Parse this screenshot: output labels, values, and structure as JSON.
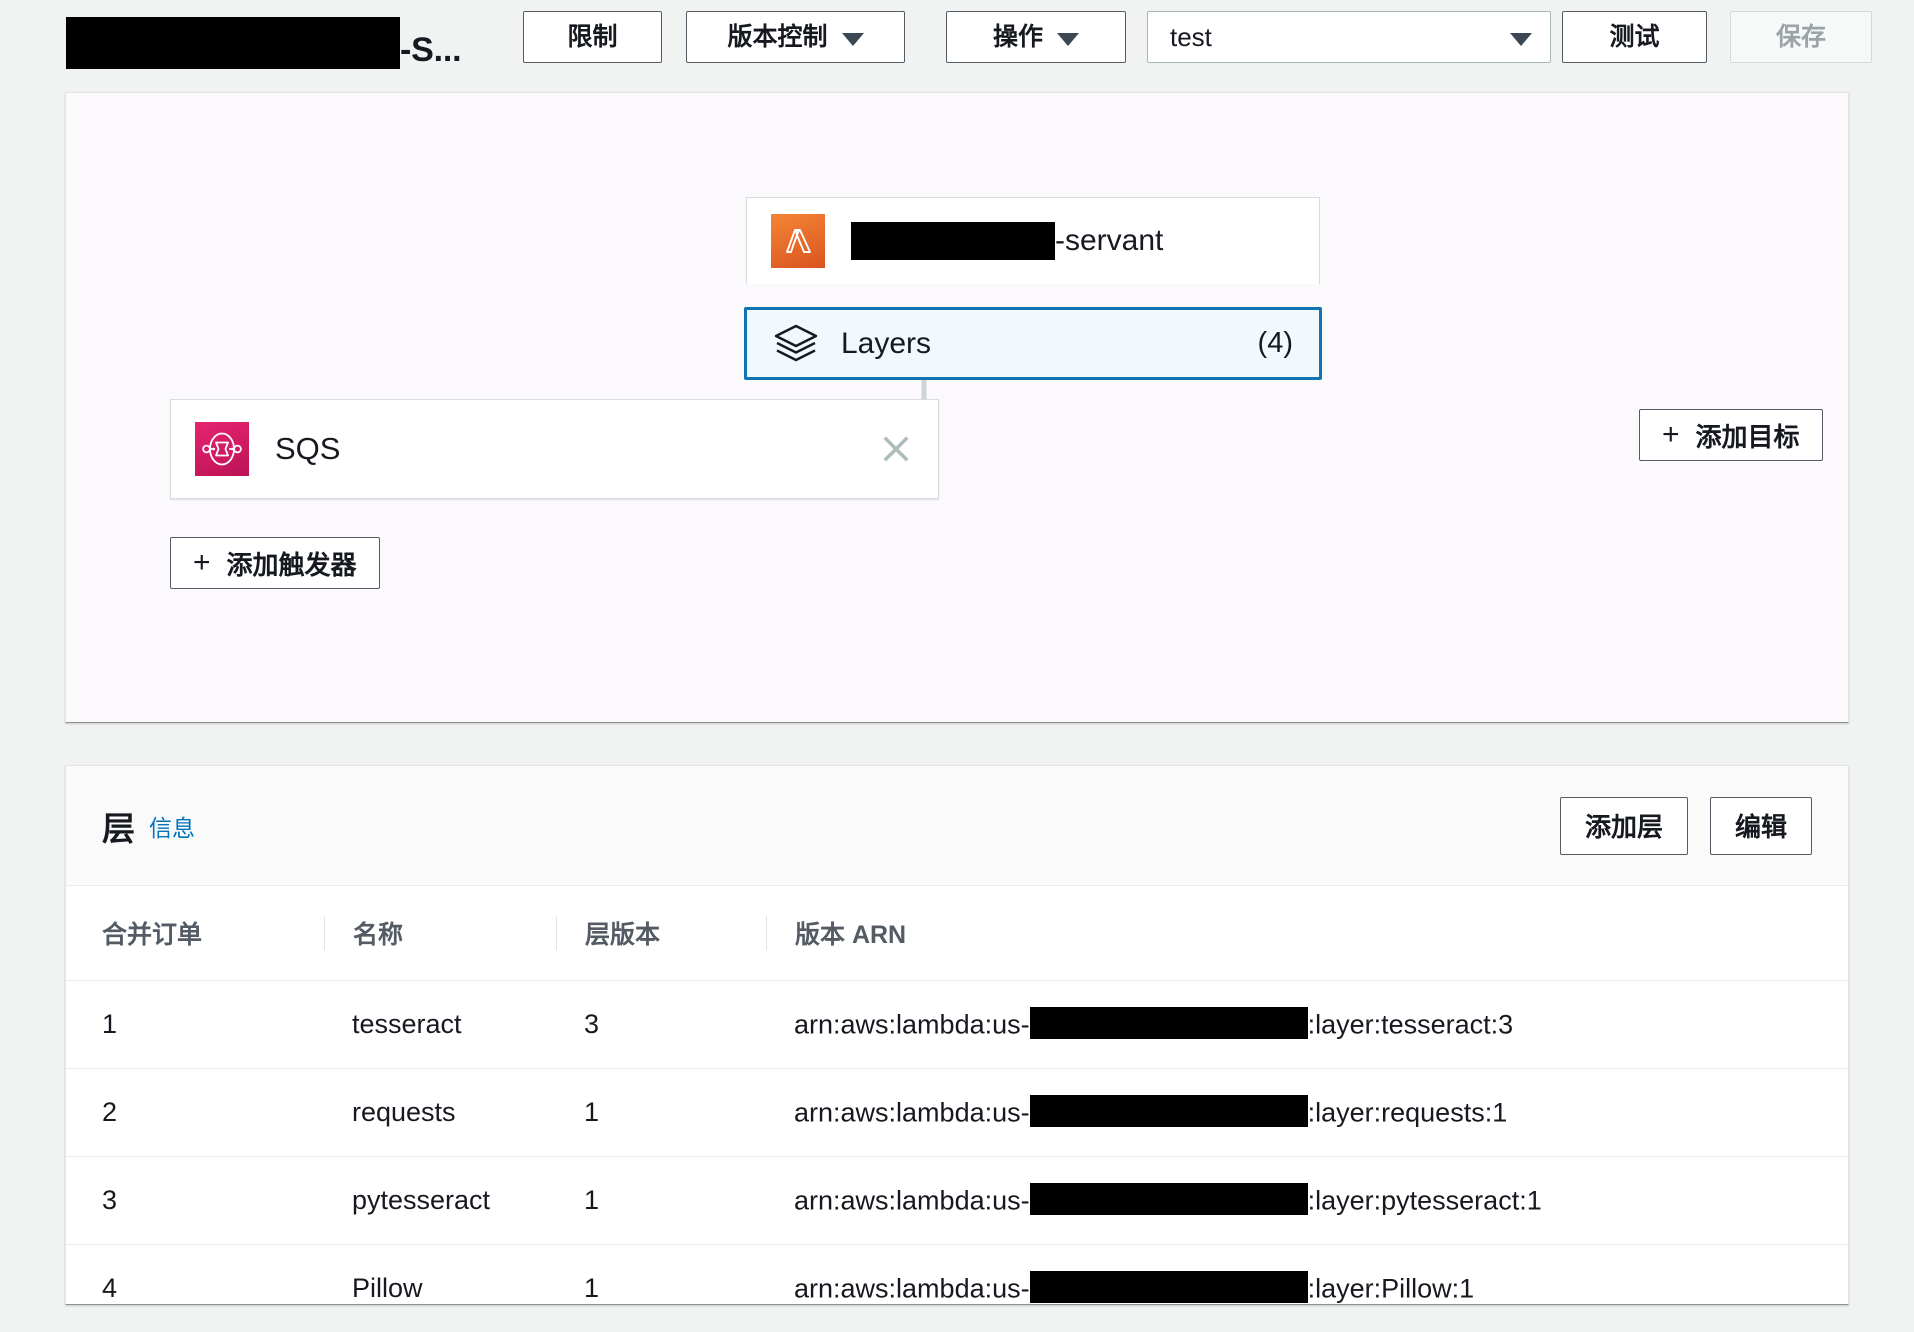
{
  "topbar": {
    "function_title_suffix": "-S...",
    "function_title_redacted": true,
    "buttons": {
      "throttle": "限制",
      "version_control": "版本控制",
      "actions": "操作",
      "test": "测试",
      "save": "保存"
    },
    "test_event_select": {
      "value": "test"
    }
  },
  "diagram": {
    "lambda_node": {
      "name_suffix": "-servant",
      "icon": "aws-lambda-icon"
    },
    "layers_node": {
      "label": "Layers",
      "count": "(4)",
      "icon": "layers-stack-icon",
      "selected": true
    },
    "trigger_card": {
      "label": "SQS",
      "icon": "aws-sqs-icon",
      "close_icon": "close-icon"
    },
    "add_trigger_button": "添加触发器",
    "add_target_button": "添加目标",
    "plus_glyph": "+"
  },
  "layers_panel": {
    "title": "层",
    "info_link": "信息",
    "add_layer_button": "添加层",
    "edit_button": "编辑",
    "columns": [
      "合并订单",
      "名称",
      "层版本",
      "版本 ARN"
    ],
    "rows": [
      {
        "merge_order": "1",
        "name": "tesseract",
        "layer_version": "3",
        "arn_prefix": "arn:aws:lambda:us-",
        "arn_suffix": ":layer:tesseract:3"
      },
      {
        "merge_order": "2",
        "name": "requests",
        "layer_version": "1",
        "arn_prefix": "arn:aws:lambda:us-",
        "arn_suffix": ":layer:requests:1"
      },
      {
        "merge_order": "3",
        "name": "pytesseract",
        "layer_version": "1",
        "arn_prefix": "arn:aws:lambda:us-",
        "arn_suffix": ":layer:pytesseract:1"
      },
      {
        "merge_order": "4",
        "name": "Pillow",
        "layer_version": "1",
        "arn_prefix": "arn:aws:lambda:us-",
        "arn_suffix": ":layer:Pillow:1"
      }
    ]
  },
  "colors": {
    "accent_blue": "#0f74b0",
    "link_blue": "#0073bb",
    "lambda_orange": "#d9541f",
    "sqs_pink": "#bc1356",
    "page_bg": "#f1f3f3",
    "selected_bg": "#f1f8fe"
  }
}
